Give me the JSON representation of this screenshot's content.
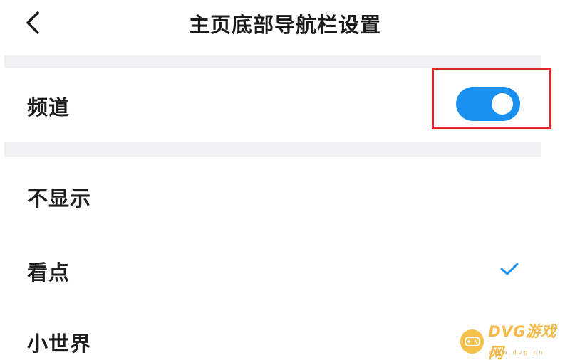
{
  "header": {
    "back_icon": "chevron-left-icon",
    "title": "主页底部导航栏设置"
  },
  "channel": {
    "label": "频道",
    "toggle_on": true,
    "toggle_color": "#1a90f0",
    "highlight_color": "#e0252b"
  },
  "options": [
    {
      "label": "不显示",
      "selected": false
    },
    {
      "label": "看点",
      "selected": true
    },
    {
      "label": "小世界",
      "selected": false
    }
  ],
  "check_icon": "checkmark-icon",
  "check_color": "#1a90f0",
  "watermark": {
    "text": "DVG游戏网",
    "sub": "www.dvg.cn",
    "logo_icon": "gamepad-icon",
    "color": "#f0a818"
  }
}
